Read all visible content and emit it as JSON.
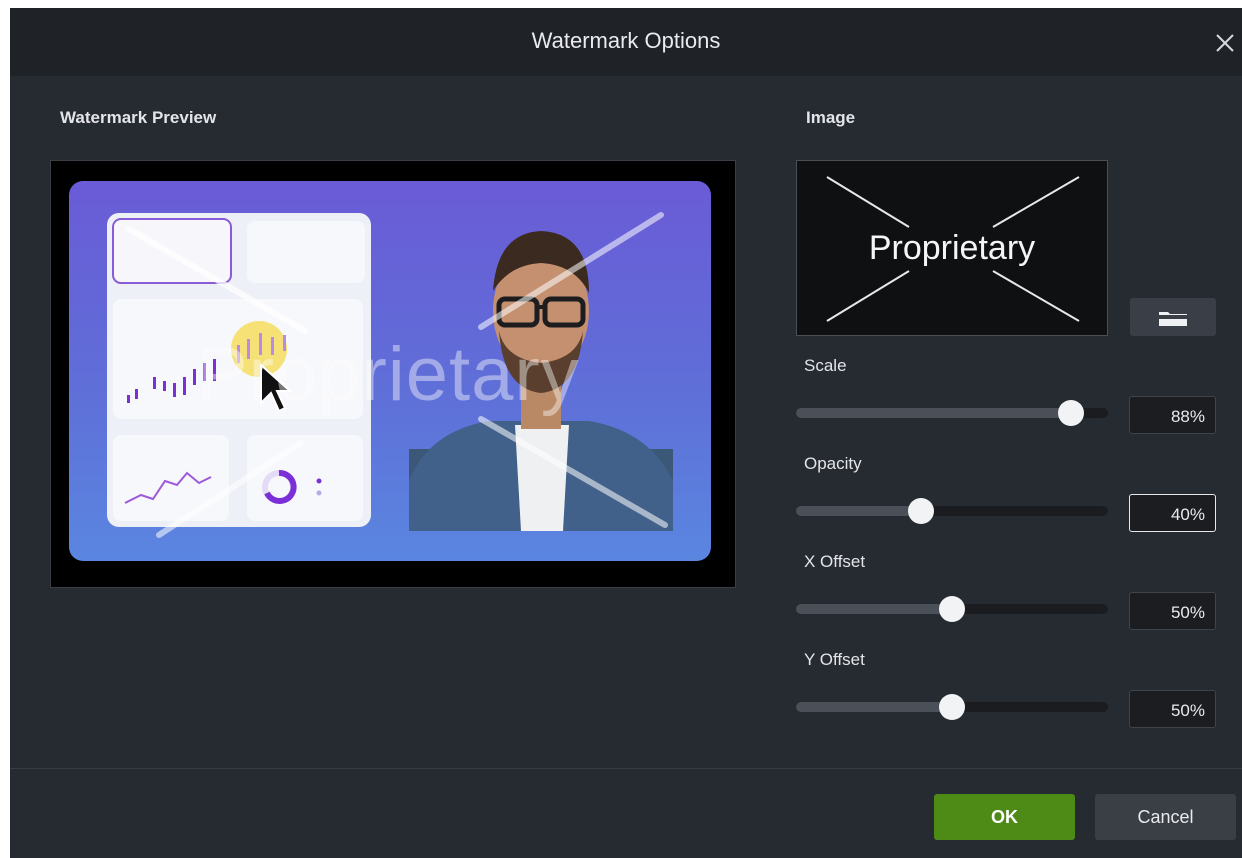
{
  "dialog": {
    "title": "Watermark Options",
    "close_icon": "close-icon"
  },
  "preview": {
    "label": "Watermark Preview",
    "watermark_text": "Proprietary"
  },
  "image": {
    "label": "Image",
    "thumbnail_text": "Proprietary",
    "browse_icon": "folder-icon"
  },
  "sliders": {
    "scale": {
      "label": "Scale",
      "value": "88%",
      "level": 0.88
    },
    "opacity": {
      "label": "Opacity",
      "value": "40%",
      "level": 0.4
    },
    "x_offset": {
      "label": "X Offset",
      "value": "50%",
      "level": 0.5
    },
    "y_offset": {
      "label": "Y Offset",
      "value": "50%",
      "level": 0.5
    }
  },
  "footer": {
    "ok_label": "OK",
    "cancel_label": "Cancel"
  },
  "colors": {
    "dialog_bg": "#262a31",
    "titlebar_bg": "#1f2227",
    "ok_green": "#4d8a16",
    "preview_gradient_top": "#6a5bd6",
    "preview_gradient_bottom": "#5a86e0",
    "chart_accent": "#7b2fd6"
  }
}
